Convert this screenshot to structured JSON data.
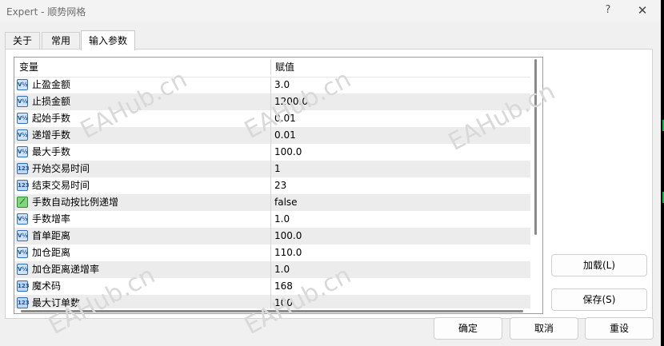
{
  "window": {
    "title": "Expert - 顺势网格",
    "help_glyph": "?",
    "close_glyph": "✕"
  },
  "tabs": [
    {
      "label": "关于",
      "active": false
    },
    {
      "label": "常用",
      "active": false
    },
    {
      "label": "输入参数",
      "active": true
    }
  ],
  "grid": {
    "headers": {
      "name": "变量",
      "value": "赋值"
    },
    "rows": [
      {
        "icon": "double-value-icon",
        "glyph": "V½",
        "name": "止盈金额",
        "value": "3.0"
      },
      {
        "icon": "double-value-icon",
        "glyph": "V½",
        "name": "止损金额",
        "value": "1200.0"
      },
      {
        "icon": "double-value-icon",
        "glyph": "V½",
        "name": "起始手数",
        "value": "0.01"
      },
      {
        "icon": "double-value-icon",
        "glyph": "V½",
        "name": "递增手数",
        "value": "0.01"
      },
      {
        "icon": "double-value-icon",
        "glyph": "V½",
        "name": "最大手数",
        "value": "100.0"
      },
      {
        "icon": "integer-value-icon",
        "glyph": "123",
        "name": "开始交易时间",
        "value": "1"
      },
      {
        "icon": "integer-value-icon",
        "glyph": "123",
        "name": "结束交易时间",
        "value": "23"
      },
      {
        "icon": "boolean-value-icon",
        "glyph": "⟋",
        "name": "手数自动按比例递增",
        "value": "false"
      },
      {
        "icon": "double-value-icon",
        "glyph": "V½",
        "name": "手数增率",
        "value": "1.0"
      },
      {
        "icon": "double-value-icon",
        "glyph": "V½",
        "name": "首单距离",
        "value": "100.0"
      },
      {
        "icon": "double-value-icon",
        "glyph": "V½",
        "name": "加仓距离",
        "value": "110.0"
      },
      {
        "icon": "double-value-icon",
        "glyph": "V½",
        "name": "加仓距离递增率",
        "value": "1.0"
      },
      {
        "icon": "integer-value-icon",
        "glyph": "123",
        "name": "魔术码",
        "value": "168"
      },
      {
        "icon": "integer-value-icon",
        "glyph": "123",
        "name": "最大订单数",
        "value": "100"
      }
    ]
  },
  "side_buttons": {
    "load": "加载(L)",
    "save": "保存(S)"
  },
  "footer_buttons": {
    "ok": "确定",
    "cancel": "取消",
    "reset": "重设"
  },
  "watermark": "EAHub.cn",
  "colors": {
    "bool_icon": "#7fd67f",
    "value_icon": "#cfe3fa",
    "alt_row": "#ececec"
  }
}
